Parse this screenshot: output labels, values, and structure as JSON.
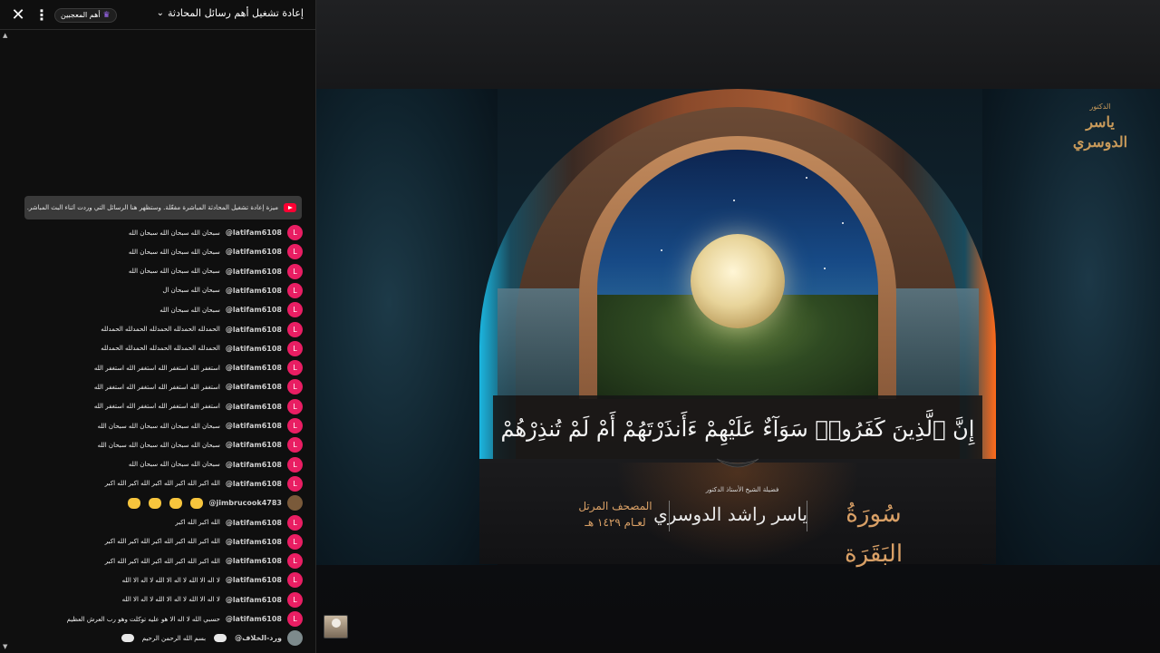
{
  "chat": {
    "title": "إعادة تشغيل أهم رسائل المحادثة",
    "chevron_icon": "chevron-down-icon",
    "members_chip": "أهم المعجبين",
    "banner": "ميزة إعادة تشغيل المحادثة المباشرة مفعّلة. وستظهر هنا الرسائل التي وردت أثناء البث المباشر.",
    "messages": [
      {
        "author": "@latifam6108",
        "text": "سبحان الله سبحان الله سبحان الله",
        "avatar": "L"
      },
      {
        "author": "@latifam6108",
        "text": "سبحان الله سبحان الله سبحان الله",
        "avatar": "L"
      },
      {
        "author": "@latifam6108",
        "text": "سبحان الله سبحان الله سبحان الله",
        "avatar": "L"
      },
      {
        "author": "@latifam6108",
        "text": "سبحان الله سبحان ال",
        "avatar": "L"
      },
      {
        "author": "@latifam6108",
        "text": "سبحان الله سبحان الله",
        "avatar": "L"
      },
      {
        "author": "@latifam6108",
        "text": "الحمدلله الحمدلله الحمدلله الحمدلله الحمدلله",
        "avatar": "L"
      },
      {
        "author": "@latifam6108",
        "text": "الحمدلله الحمدلله الحمدلله الحمدلله الحمدلله",
        "avatar": "L"
      },
      {
        "author": "@latifam6108",
        "text": "استغفر الله استغفر الله استغفر الله استغفر الله",
        "avatar": "L"
      },
      {
        "author": "@latifam6108",
        "text": "استغفر الله استغفر الله استغفر الله استغفر الله",
        "avatar": "L"
      },
      {
        "author": "@latifam6108",
        "text": "استغفر الله استغفر الله استغفر الله استغفر الله",
        "avatar": "L"
      },
      {
        "author": "@latifam6108",
        "text": "سبحان الله سبحان الله سبحان الله سبحان الله",
        "avatar": "L"
      },
      {
        "author": "@latifam6108",
        "text": "سبحان الله سبحان الله سبحان الله سبحان الله",
        "avatar": "L"
      },
      {
        "author": "@latifam6108",
        "text": "سبحان الله سبحان الله سبحان الله",
        "avatar": "L"
      },
      {
        "author": "@latifam6108",
        "text": "الله اكبر الله اكبر الله اكبر الله اكبر الله اكبر",
        "avatar": "L"
      },
      {
        "author": "@jimbrucook4783",
        "text": "",
        "avatar": ""
      },
      {
        "author": "@latifam6108",
        "text": "الله اكبر الله اكبر",
        "avatar": "L"
      },
      {
        "author": "@latifam6108",
        "text": "الله اكبر الله اكبر الله اكبر الله اكبر الله اكبر",
        "avatar": "L"
      },
      {
        "author": "@latifam6108",
        "text": "الله اكبر الله اكبر الله اكبر الله اكبر الله اكبر",
        "avatar": "L"
      },
      {
        "author": "@latifam6108",
        "text": "لا اله الا الله لا اله الا الله لا اله الا الله",
        "avatar": "L"
      },
      {
        "author": "@latifam6108",
        "text": "لا اله الا الله لا اله الا الله لا اله الا الله",
        "avatar": "L"
      },
      {
        "author": "@latifam6108",
        "text": "حسبي الله لا اله الا هو عليه توكلت وهو رب العرش العظيم",
        "avatar": "L"
      },
      {
        "author": "@ورد-الخلاف",
        "text": "بسم الله الرحمن الرحيم",
        "avatar": ""
      }
    ]
  },
  "video": {
    "verse": "إِنَّ ٱلَّذِينَ كَفَرُوا۟ سَوَآءٌ عَلَيْهِمْ ءَأَنذَرْتَهُمْ أَمْ لَمْ تُنذِرْهُمْ",
    "surah": "سُورَةُ البَقَرَة",
    "reciter_title": "فضيلة الشيخ الأستاذ الدكتور",
    "reciter_name": "ياسر راشد الدوسري",
    "mushaf_line1": "المصحف المرتل",
    "mushaf_line2": "لعـام ١٤٢٩ هـ",
    "logo_small": "الدكتور",
    "logo_name": "ياسر الدوسري"
  }
}
